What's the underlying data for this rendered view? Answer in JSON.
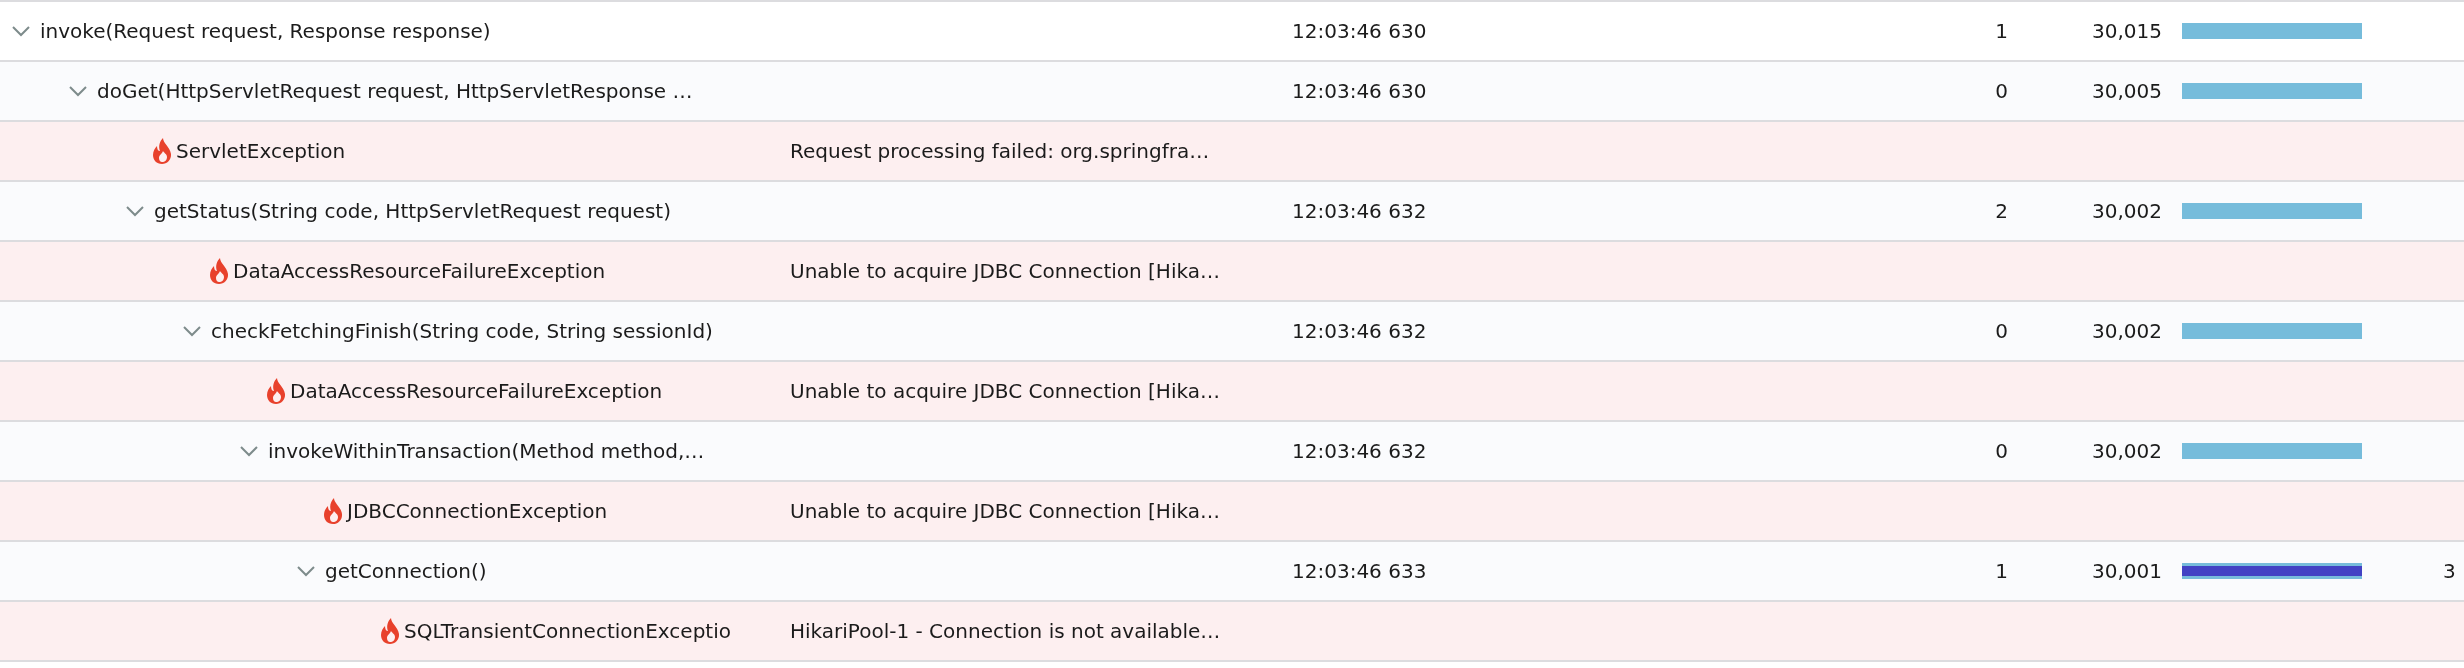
{
  "tree": [
    {
      "kind": "method",
      "name": "invoke(Request request, Response response)",
      "time": "12:03:46 630",
      "count": "1",
      "duration": "30,015",
      "bar": {
        "level": 1,
        "highlight": false
      },
      "expanded": true,
      "children": [
        {
          "kind": "method",
          "name": "doGet(HttpServletRequest request, HttpServletResponse …",
          "time": "12:03:46 630",
          "count": "0",
          "duration": "30,005",
          "bar": {
            "level": 1,
            "highlight": false
          },
          "expanded": true,
          "children": [
            {
              "kind": "exception",
              "name": "ServletException",
              "message": "Request processing failed: org.springfra…"
            },
            {
              "kind": "method",
              "name": "getStatus(String code, HttpServletRequest request)",
              "time": "12:03:46 632",
              "count": "2",
              "duration": "30,002",
              "bar": {
                "level": 1,
                "highlight": false
              },
              "expanded": true,
              "children": [
                {
                  "kind": "exception",
                  "name": "DataAccessResourceFailureException",
                  "message": "Unable to acquire JDBC Connection [Hika…"
                },
                {
                  "kind": "method",
                  "name": "checkFetchingFinish(String code, String sessionId)",
                  "time": "12:03:46 632",
                  "count": "0",
                  "duration": "30,002",
                  "bar": {
                    "level": 1,
                    "highlight": false
                  },
                  "expanded": true,
                  "children": [
                    {
                      "kind": "exception",
                      "name": "DataAccessResourceFailureException",
                      "message": "Unable to acquire JDBC Connection [Hika…"
                    },
                    {
                      "kind": "method",
                      "name": "invokeWithinTransaction(Method method,…",
                      "time": "12:03:46 632",
                      "count": "0",
                      "duration": "30,002",
                      "bar": {
                        "level": 1,
                        "highlight": false
                      },
                      "expanded": true,
                      "children": [
                        {
                          "kind": "exception",
                          "name": "JDBCConnectionException",
                          "message": "Unable to acquire JDBC Connection [Hika…"
                        },
                        {
                          "kind": "method",
                          "name": "getConnection()",
                          "time": "12:03:46 633",
                          "count": "1",
                          "duration": "30,001",
                          "bar": {
                            "level": 1,
                            "highlight": true
                          },
                          "column_7": "3",
                          "expanded": true,
                          "children": [
                            {
                              "kind": "exception",
                              "name": "SQLTransientConnectionExceptio",
                              "message": "HikariPool-1 - Connection is not available…"
                            }
                          ]
                        }
                      ]
                    }
                  ]
                }
              ]
            }
          ]
        }
      ]
    }
  ]
}
